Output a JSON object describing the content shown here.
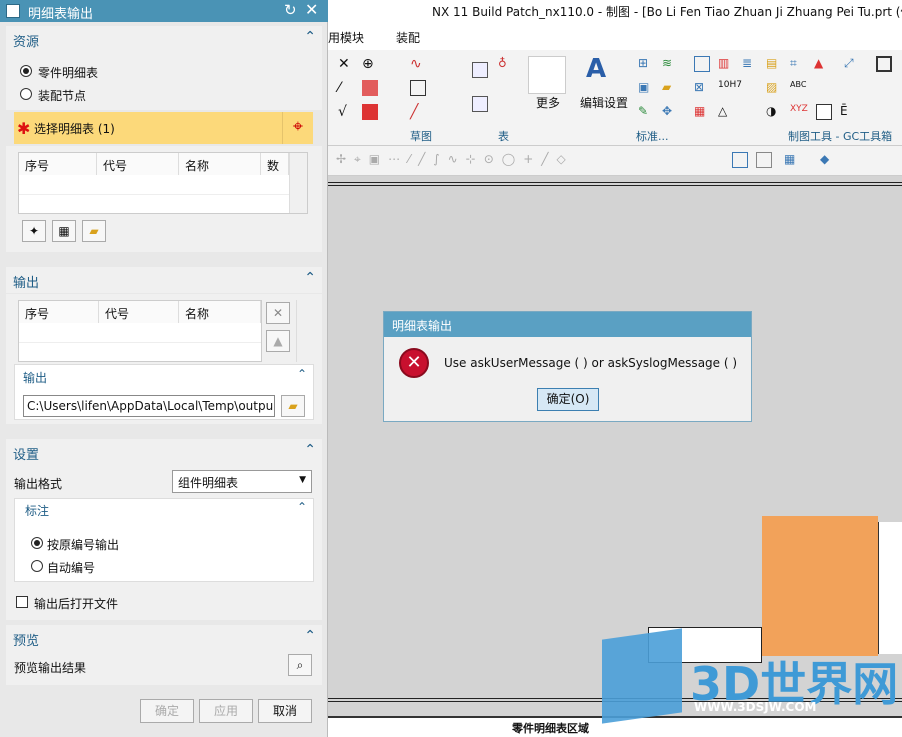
{
  "panel": {
    "title": "明细表输出",
    "resource": {
      "header": "资源",
      "radio1": "零件明细表",
      "radio2": "装配节点",
      "select_label": "选择明细表 (1)",
      "columns": [
        "序号",
        "代号",
        "名称",
        "数"
      ]
    },
    "output": {
      "header": "输出",
      "columns": [
        "序号",
        "代号",
        "名称"
      ],
      "sub_header": "输出",
      "path": "C:\\Users\\lifen\\AppData\\Local\\Temp\\outpu"
    },
    "settings": {
      "header": "设置",
      "format_label": "输出格式",
      "format_value": "组件明细表",
      "annot_header": "标注",
      "radio1": "按原编号输出",
      "radio2": "自动编号",
      "checkbox": "输出后打开文件"
    },
    "preview": {
      "header": "预览",
      "label": "预览输出结果"
    },
    "buttons": {
      "ok": "确定",
      "apply": "应用",
      "cancel": "取消"
    }
  },
  "app": {
    "title": "NX 11  Build Patch_nx110.0 - 制图 - [Bo Li Fen Tiao Zhuan Ji Zhuang Pei Tu.prt  (修",
    "menu": [
      "用模块",
      "装配"
    ],
    "ribbon_groups": [
      "草图",
      "表",
      "标准...",
      "制图工具 - GC工具箱"
    ],
    "more_label": "更多",
    "edit_settings_label": "编辑设置",
    "status_text": "零件明细表区域"
  },
  "dialog": {
    "title": "明细表输出",
    "message": "Use askUserMessage ( ) or askSyslogMessage ( )",
    "ok_label": "确定(O)"
  },
  "watermark": {
    "main": "3D世界网",
    "sub": "WWW.3DSJW.COM"
  }
}
